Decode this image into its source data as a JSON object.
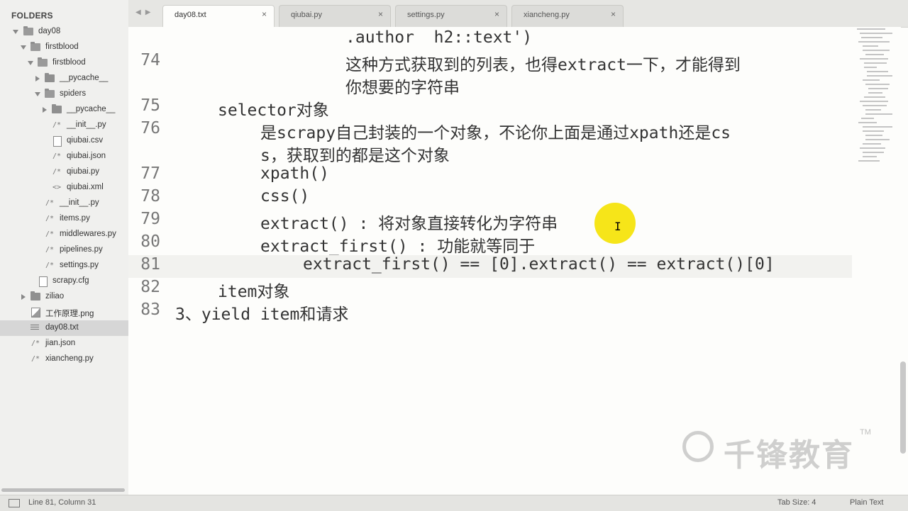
{
  "sidebar": {
    "header": "FOLDERS",
    "items": [
      {
        "label": "day08"
      },
      {
        "label": "firstblood"
      },
      {
        "label": "firstblood"
      },
      {
        "label": "__pycache__"
      },
      {
        "label": "spiders"
      },
      {
        "label": "__pycache__"
      },
      {
        "label": "__init__.py"
      },
      {
        "label": "qiubai.csv"
      },
      {
        "label": "qiubai.json"
      },
      {
        "label": "qiubai.py"
      },
      {
        "label": "qiubai.xml"
      },
      {
        "label": "__init__.py"
      },
      {
        "label": "items.py"
      },
      {
        "label": "middlewares.py"
      },
      {
        "label": "pipelines.py"
      },
      {
        "label": "settings.py"
      },
      {
        "label": "scrapy.cfg"
      },
      {
        "label": "ziliao"
      },
      {
        "label": "工作原理.png"
      },
      {
        "label": "day08.txt"
      },
      {
        "label": "jian.json"
      },
      {
        "label": "xiancheng.py"
      }
    ]
  },
  "tabs": [
    {
      "label": "day08.txt",
      "close": "×"
    },
    {
      "label": "qiubai.py",
      "close": "×"
    },
    {
      "label": "settings.py",
      "close": "×"
    },
    {
      "label": "xiancheng.py",
      "close": "×"
    }
  ],
  "editor": {
    "lines": [
      {
        "num": "",
        "text": ".author  h2::text')"
      },
      {
        "num": "74",
        "text": "这种方式获取到的列表，也得extract一下，才能得到"
      },
      {
        "num": "",
        "text": "你想要的字符串"
      },
      {
        "num": "75",
        "text": "selector对象"
      },
      {
        "num": "76",
        "text": "是scrapy自己封装的一个对象，不论你上面是通过xpath还是cs"
      },
      {
        "num": "",
        "text": "s，获取到的都是这个对象"
      },
      {
        "num": "77",
        "text": "xpath()"
      },
      {
        "num": "78",
        "text": "css()"
      },
      {
        "num": "79",
        "text": "extract() : 将对象直接转化为字符串"
      },
      {
        "num": "80",
        "text": "extract_first() : 功能就等同于"
      },
      {
        "num": "81",
        "text": "extract_first() == [0].extract() == extract()[0]"
      },
      {
        "num": "82",
        "text": "item对象"
      },
      {
        "num": "83",
        "text": "3、yield item和请求"
      }
    ]
  },
  "watermark": {
    "text": "千锋教育",
    "tm": "TM"
  },
  "status": {
    "position": "Line 81, Column 31",
    "tab_size": "Tab Size: 4",
    "syntax": "Plain Text"
  }
}
